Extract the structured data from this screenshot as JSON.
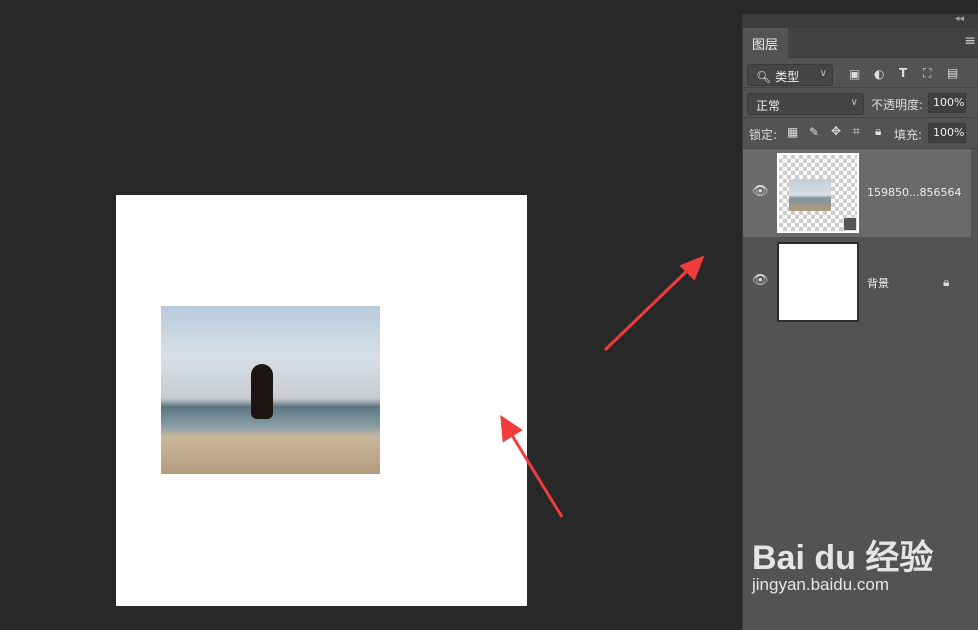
{
  "panel": {
    "collapse_icon": "double-chevron-left",
    "tab": "图层",
    "menu_icon": "hamburger",
    "filter": {
      "label": "类型",
      "icons": [
        "image-filter",
        "adjustment-filter",
        "type-filter",
        "shape-filter",
        "smart-object-filter"
      ]
    },
    "blend_mode": "正常",
    "opacity_label": "不透明度:",
    "opacity": "100%",
    "lock_label": "锁定:",
    "fill_label": "填充:",
    "fill": "100%",
    "layers": [
      {
        "name": "159850...856564",
        "visible": true,
        "selected": true,
        "smart_object": true
      },
      {
        "name": "背景",
        "visible": true,
        "locked": true
      }
    ]
  },
  "watermark": {
    "logo": "Bai du 经验",
    "url": "jingyan.baidu.com"
  },
  "colors": {
    "arrow": "#f03c3c",
    "panel": "#535353",
    "workspace": "#282828"
  }
}
